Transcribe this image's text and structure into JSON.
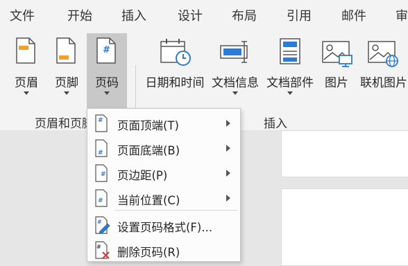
{
  "menu": {
    "items": [
      "文件",
      "开始",
      "插入",
      "设计",
      "布局",
      "引用",
      "邮件",
      "审"
    ]
  },
  "ribbon": {
    "buttons": {
      "header": "页眉",
      "footer": "页脚",
      "page_number": "页码",
      "date_time": "日期和时间",
      "doc_info": "文档信息",
      "doc_parts": "文档部件",
      "picture": "图片",
      "online_picture": "联机图片"
    },
    "groups": {
      "header_footer": "页眉和页脚",
      "insert": "插入"
    }
  },
  "dropdown": {
    "items": [
      {
        "label": "页面顶端(T)",
        "submenu": true
      },
      {
        "label": "页面底端(B)",
        "submenu": true
      },
      {
        "label": "页边距(P)",
        "submenu": true
      },
      {
        "label": "当前位置(C)",
        "submenu": true
      },
      {
        "label": "设置页码格式(F)...",
        "submenu": false
      },
      {
        "label": "删除页码(R)",
        "submenu": false
      }
    ]
  },
  "colors": {
    "accent_blue": "#2b7cd3",
    "accent_orange": "#f0a030",
    "delete_red": "#d9342b"
  }
}
